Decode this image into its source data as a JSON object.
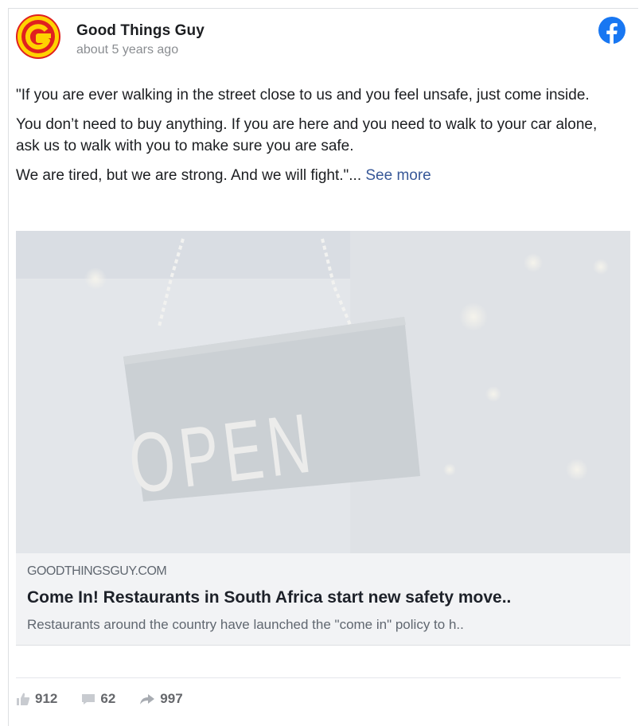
{
  "post": {
    "page_name": "Good Things Guy",
    "time": "about 5 years ago",
    "paragraphs": [
      "\"If you are ever walking in the street close to us and you feel unsafe, just come inside.",
      "You don’t need to buy anything. If you are here and you need to walk to your car alone, ask us to walk with you to make sure you are safe.",
      " We are tired, but we are strong. And we will fight.\"... "
    ],
    "see_more": "See more"
  },
  "image": {
    "sign_text": "OPEN"
  },
  "link": {
    "domain": "GOODTHINGSGUY.COM",
    "title": "Come In! Restaurants in South Africa start new safety move..",
    "description": "Restaurants around the country have launched the \"come in\" policy to h.."
  },
  "stats": {
    "likes": "912",
    "comments": "62",
    "shares": "997"
  },
  "colors": {
    "link_blue": "#385898",
    "facebook_blue": "#1877f2",
    "logo_red": "#e02020",
    "logo_yellow": "#ffd200"
  },
  "icons": {
    "avatar": "good-things-guy-logo",
    "brand": "facebook-icon",
    "like": "thumbs-up-icon",
    "comment": "comment-icon",
    "share": "share-arrow-icon"
  }
}
